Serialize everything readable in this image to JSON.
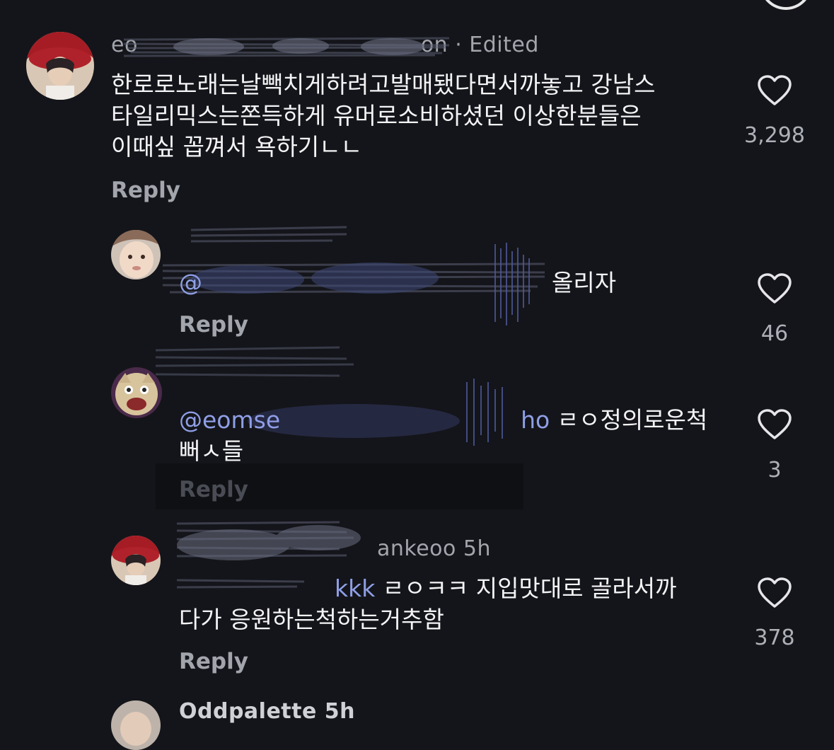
{
  "comments": [
    {
      "username": "eo",
      "meta": "on · Edited",
      "lines": [
        "한로로노래는날빽치게하려고발매됐다면서까놓고 강남스",
        "타일리믹스는쫀득하게 유머로소비하셨던 이상한분들은",
        "이때싶 꼽껴서 욕하기ㄴㄴ"
      ],
      "reply": "Reply",
      "likes": "3,298"
    },
    {
      "mention": "@",
      "text": "올리자",
      "reply": "Reply",
      "likes": "46"
    },
    {
      "mention_start": "@eomse",
      "mention_end": "ho",
      "line1": " ㄹㅇ정의로운척",
      "line2": "뻐ㅅ들",
      "reply": "Reply",
      "likes": "3"
    },
    {
      "meta": "ankeoo 5h",
      "mention": "kkk",
      "line1": " ㄹㅇㅋㅋ 지입맛대로 골라서까",
      "line2": "다가 응원하는척하는거추함",
      "reply": "Reply",
      "likes": "378"
    },
    {
      "username": "Oddpalette 5h"
    }
  ],
  "colors": {
    "background": "#14151a",
    "text": "#f4f4f6",
    "secondary": "#a3a5ad",
    "mention": "#8f9fe6"
  },
  "icons": [
    "heart-icon",
    "avatar"
  ]
}
